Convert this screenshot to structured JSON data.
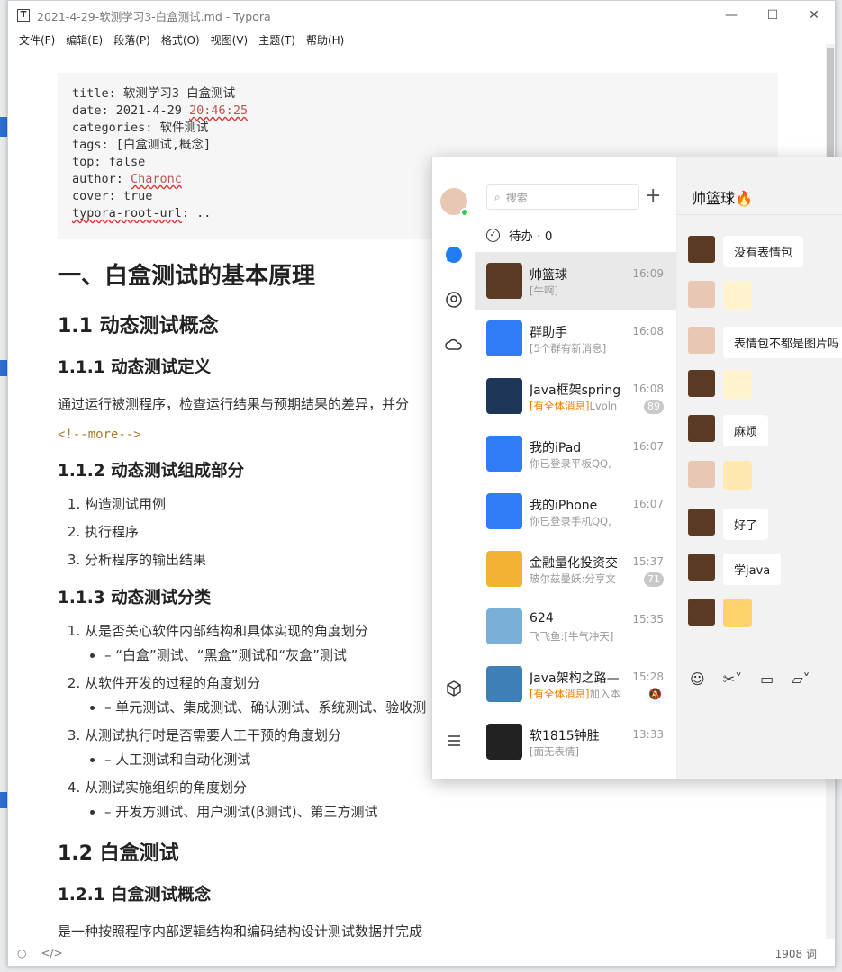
{
  "window": {
    "title": "2021-4-29-软测学习3-白盒测试.md - Typora",
    "app_icon_letter": "T",
    "minimize": "—",
    "maximize": "☐",
    "close": "✕"
  },
  "menu": [
    "文件(F)",
    "编辑(E)",
    "段落(P)",
    "格式(O)",
    "视图(V)",
    "主题(T)",
    "帮助(H)"
  ],
  "yaml": {
    "title": "title: 软测学习3 白盒测试",
    "date_prefix": "date: 2021-4-29 ",
    "date_time": "20:46:25",
    "categories": "categories: 软件测试",
    "tags": "tags: [白盒测试,概念]",
    "top": "top: false",
    "author_prefix": "author: ",
    "author_name": "Charonc",
    "cover": "cover: true",
    "root_key": "typora-root-url",
    "root_val": ": .."
  },
  "doc": {
    "h1": "一、白盒测试的基本原理",
    "h2_1": "1.1 动态测试概念",
    "h3_1": "1.1.1 动态测试定义",
    "p_1": "通过运行被测程序，检查运行结果与预期结果的差异，并分",
    "more": "<!--more-->",
    "h3_2": "1.1.2 动态测试组成部分",
    "list_1": [
      "构造测试用例",
      "执行程序",
      "分析程序的输出结果"
    ],
    "h3_3": "1.1.3 动态测试分类",
    "list_2": [
      {
        "item": "从是否关心软件内部结构和具体实现的角度划分",
        "sub": "– “白盒”测试、“黑盒”测试和“灰盒”测试"
      },
      {
        "item": "从软件开发的过程的角度划分",
        "sub": "– 单元测试、集成测试、确认测试、系统测试、验收测"
      },
      {
        "item": "从测试执行时是否需要人工干预的角度划分",
        "sub": "– 人工测试和自动化测试"
      },
      {
        "item": "从测试实施组织的角度划分",
        "sub": "– 开发方测试、用户测试(β测试)、第三方测试"
      }
    ],
    "h2_2": "1.2 白盒测试",
    "h3_4": "1.2.1 白盒测试概念",
    "p_2": "是一种按照程序内部逻辑结构和编码结构设计测试数据并完成"
  },
  "status": {
    "word_count": "1908 词"
  },
  "qq": {
    "search_placeholder": "搜索",
    "plus": "+",
    "todo": "待办 · 0",
    "conversations": [
      {
        "name": "帅篮球",
        "time": "16:09",
        "preview": "[牛啊]",
        "highlight": "",
        "badge": "",
        "color": "#5a3a22"
      },
      {
        "name": "群助手",
        "time": "16:08",
        "preview": "[5个群有新消息]",
        "highlight": "",
        "badge": "",
        "color": "#2f7cf6"
      },
      {
        "name": "Java框架spring",
        "time": "16:08",
        "preview": "Lvoln",
        "highlight": "[有全体消息]",
        "badge": "89",
        "color": "#1d3557"
      },
      {
        "name": "我的iPad",
        "time": "16:07",
        "preview": "你已登录平板QQ,",
        "highlight": "",
        "badge": "",
        "color": "#2f7cf6"
      },
      {
        "name": "我的iPhone",
        "time": "16:07",
        "preview": "你已登录手机QQ,",
        "highlight": "",
        "badge": "",
        "color": "#2f7cf6"
      },
      {
        "name": "金融量化投资交",
        "time": "15:37",
        "preview": "玻尔兹曼妖:分享文",
        "highlight": "",
        "badge": "71",
        "color": "#f2b233"
      },
      {
        "name": "624",
        "time": "15:35",
        "preview": "飞飞鱼:[牛气冲天]",
        "highlight": "",
        "badge": "",
        "color": "#7ab0d8"
      },
      {
        "name": "Java架构之路—",
        "time": "15:28",
        "preview": "加入本",
        "highlight": "[有全体消息]",
        "badge": "",
        "mute": "🔕",
        "color": "#3e7fb8"
      },
      {
        "name": "软1815钟胜",
        "time": "13:33",
        "preview": "[面无表情]",
        "highlight": "",
        "badge": "",
        "color": "#222222"
      }
    ],
    "chat_title": "帅篮球🔥",
    "messages": [
      "没有表情包",
      "表情包不都是图片吗",
      "麻烦",
      "好了",
      "学java"
    ]
  }
}
